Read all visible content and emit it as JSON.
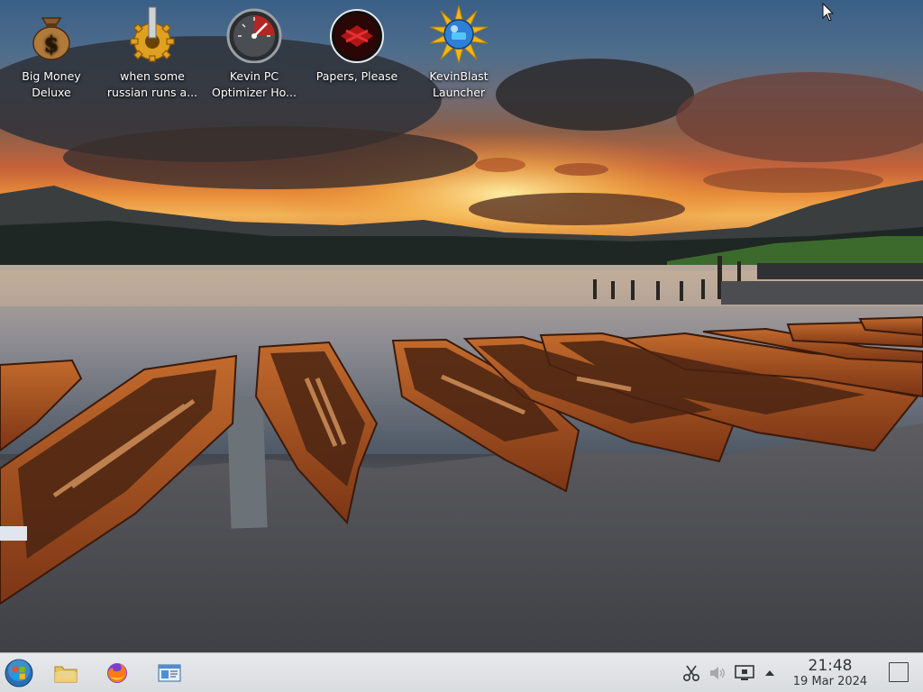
{
  "desktop": {
    "icons": [
      {
        "label": "Big Money\nDeluxe",
        "icon": "money-bag-icon"
      },
      {
        "label": "when some\nrussian runs a...",
        "icon": "gear-icon"
      },
      {
        "label": "Kevin PC\nOptimizer Ho...",
        "icon": "gauge-icon"
      },
      {
        "label": "Papers, Please",
        "icon": "papers-please-icon"
      },
      {
        "label": "KevinBlast\nLauncher",
        "icon": "kevinblast-icon"
      }
    ]
  },
  "taskbar": {
    "launchers": [
      {
        "name": "start-menu",
        "icon": "start-orb-icon"
      },
      {
        "name": "file-manager",
        "icon": "folder-icon"
      },
      {
        "name": "firefox",
        "icon": "firefox-icon"
      },
      {
        "name": "system-settings",
        "icon": "settings-window-icon"
      }
    ],
    "tray": [
      {
        "name": "clipboard",
        "icon": "scissors-icon"
      },
      {
        "name": "volume",
        "icon": "speaker-muted-icon"
      },
      {
        "name": "display",
        "icon": "monitor-icon"
      },
      {
        "name": "expand",
        "icon": "chevron-up-icon"
      }
    ],
    "clock": {
      "time": "21:48",
      "date": "19 Mar 2024"
    }
  },
  "colors": {
    "taskbar_bg": "#dcdfe2",
    "text_on_desktop": "#ffffff",
    "clock_text": "#31363b"
  }
}
